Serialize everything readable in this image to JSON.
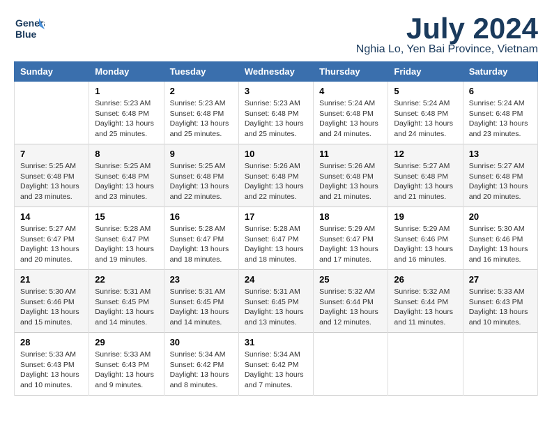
{
  "header": {
    "logo_line1": "General",
    "logo_line2": "Blue",
    "month_year": "July 2024",
    "location": "Nghia Lo, Yen Bai Province, Vietnam"
  },
  "weekdays": [
    "Sunday",
    "Monday",
    "Tuesday",
    "Wednesday",
    "Thursday",
    "Friday",
    "Saturday"
  ],
  "weeks": [
    [
      {
        "day": "",
        "info": ""
      },
      {
        "day": "1",
        "info": "Sunrise: 5:23 AM\nSunset: 6:48 PM\nDaylight: 13 hours\nand 25 minutes."
      },
      {
        "day": "2",
        "info": "Sunrise: 5:23 AM\nSunset: 6:48 PM\nDaylight: 13 hours\nand 25 minutes."
      },
      {
        "day": "3",
        "info": "Sunrise: 5:23 AM\nSunset: 6:48 PM\nDaylight: 13 hours\nand 25 minutes."
      },
      {
        "day": "4",
        "info": "Sunrise: 5:24 AM\nSunset: 6:48 PM\nDaylight: 13 hours\nand 24 minutes."
      },
      {
        "day": "5",
        "info": "Sunrise: 5:24 AM\nSunset: 6:48 PM\nDaylight: 13 hours\nand 24 minutes."
      },
      {
        "day": "6",
        "info": "Sunrise: 5:24 AM\nSunset: 6:48 PM\nDaylight: 13 hours\nand 23 minutes."
      }
    ],
    [
      {
        "day": "7",
        "info": "Sunrise: 5:25 AM\nSunset: 6:48 PM\nDaylight: 13 hours\nand 23 minutes."
      },
      {
        "day": "8",
        "info": "Sunrise: 5:25 AM\nSunset: 6:48 PM\nDaylight: 13 hours\nand 23 minutes."
      },
      {
        "day": "9",
        "info": "Sunrise: 5:25 AM\nSunset: 6:48 PM\nDaylight: 13 hours\nand 22 minutes."
      },
      {
        "day": "10",
        "info": "Sunrise: 5:26 AM\nSunset: 6:48 PM\nDaylight: 13 hours\nand 22 minutes."
      },
      {
        "day": "11",
        "info": "Sunrise: 5:26 AM\nSunset: 6:48 PM\nDaylight: 13 hours\nand 21 minutes."
      },
      {
        "day": "12",
        "info": "Sunrise: 5:27 AM\nSunset: 6:48 PM\nDaylight: 13 hours\nand 21 minutes."
      },
      {
        "day": "13",
        "info": "Sunrise: 5:27 AM\nSunset: 6:48 PM\nDaylight: 13 hours\nand 20 minutes."
      }
    ],
    [
      {
        "day": "14",
        "info": "Sunrise: 5:27 AM\nSunset: 6:47 PM\nDaylight: 13 hours\nand 20 minutes."
      },
      {
        "day": "15",
        "info": "Sunrise: 5:28 AM\nSunset: 6:47 PM\nDaylight: 13 hours\nand 19 minutes."
      },
      {
        "day": "16",
        "info": "Sunrise: 5:28 AM\nSunset: 6:47 PM\nDaylight: 13 hours\nand 18 minutes."
      },
      {
        "day": "17",
        "info": "Sunrise: 5:28 AM\nSunset: 6:47 PM\nDaylight: 13 hours\nand 18 minutes."
      },
      {
        "day": "18",
        "info": "Sunrise: 5:29 AM\nSunset: 6:47 PM\nDaylight: 13 hours\nand 17 minutes."
      },
      {
        "day": "19",
        "info": "Sunrise: 5:29 AM\nSunset: 6:46 PM\nDaylight: 13 hours\nand 16 minutes."
      },
      {
        "day": "20",
        "info": "Sunrise: 5:30 AM\nSunset: 6:46 PM\nDaylight: 13 hours\nand 16 minutes."
      }
    ],
    [
      {
        "day": "21",
        "info": "Sunrise: 5:30 AM\nSunset: 6:46 PM\nDaylight: 13 hours\nand 15 minutes."
      },
      {
        "day": "22",
        "info": "Sunrise: 5:31 AM\nSunset: 6:45 PM\nDaylight: 13 hours\nand 14 minutes."
      },
      {
        "day": "23",
        "info": "Sunrise: 5:31 AM\nSunset: 6:45 PM\nDaylight: 13 hours\nand 14 minutes."
      },
      {
        "day": "24",
        "info": "Sunrise: 5:31 AM\nSunset: 6:45 PM\nDaylight: 13 hours\nand 13 minutes."
      },
      {
        "day": "25",
        "info": "Sunrise: 5:32 AM\nSunset: 6:44 PM\nDaylight: 13 hours\nand 12 minutes."
      },
      {
        "day": "26",
        "info": "Sunrise: 5:32 AM\nSunset: 6:44 PM\nDaylight: 13 hours\nand 11 minutes."
      },
      {
        "day": "27",
        "info": "Sunrise: 5:33 AM\nSunset: 6:43 PM\nDaylight: 13 hours\nand 10 minutes."
      }
    ],
    [
      {
        "day": "28",
        "info": "Sunrise: 5:33 AM\nSunset: 6:43 PM\nDaylight: 13 hours\nand 10 minutes."
      },
      {
        "day": "29",
        "info": "Sunrise: 5:33 AM\nSunset: 6:43 PM\nDaylight: 13 hours\nand 9 minutes."
      },
      {
        "day": "30",
        "info": "Sunrise: 5:34 AM\nSunset: 6:42 PM\nDaylight: 13 hours\nand 8 minutes."
      },
      {
        "day": "31",
        "info": "Sunrise: 5:34 AM\nSunset: 6:42 PM\nDaylight: 13 hours\nand 7 minutes."
      },
      {
        "day": "",
        "info": ""
      },
      {
        "day": "",
        "info": ""
      },
      {
        "day": "",
        "info": ""
      }
    ]
  ]
}
